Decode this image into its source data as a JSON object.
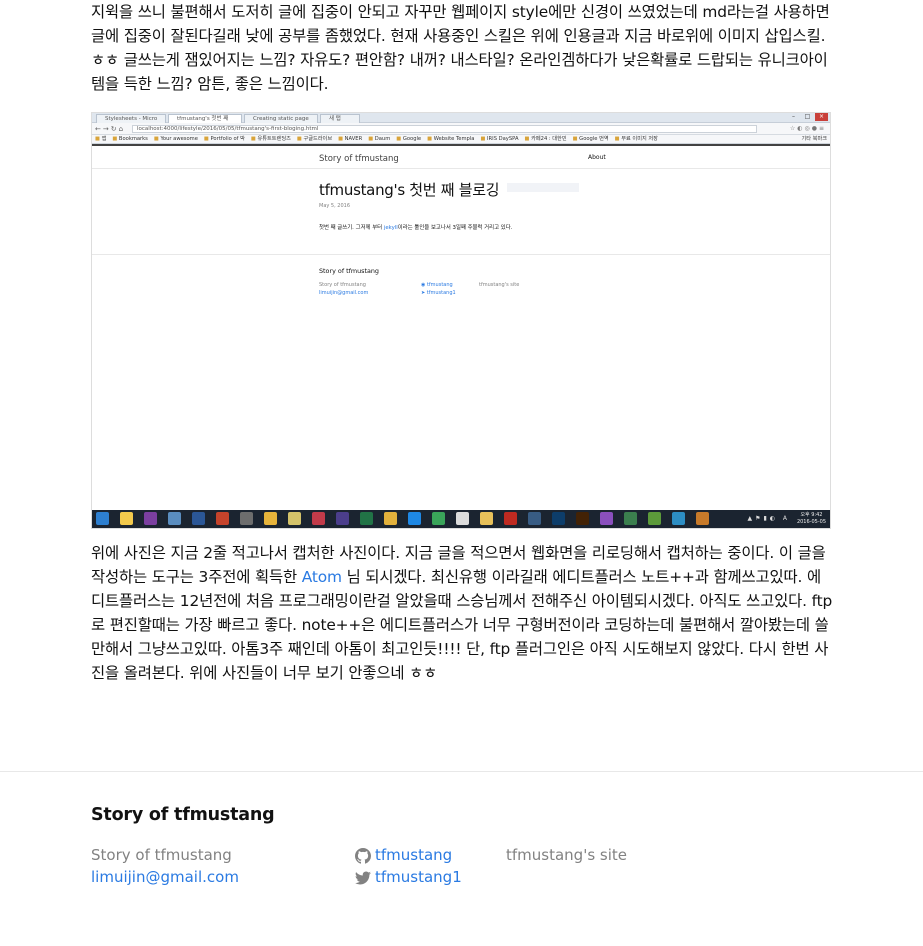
{
  "post": {
    "para1": "지윅을 쓰니 불편해서 도저히 글에 집중이 안되고 자꾸만 웹페이지 style에만 신경이 쓰였었는데 md라는걸 사용하면 글에 집중이 잘된다길래 낮에 공부를 좀했었다. 현재 사용중인 스킬은 위에 인용글과 지금 바로위에 이미지 삽입스킬. ㅎㅎ 글쓰는게 잼있어지는 느낌? 자유도? 편안함? 내꺼? 내스타일? 온라인겜하다가 낮은확률로 드랍되는 유니크아이템을 득한 느낌? 암튼, 좋은 느낌이다.",
    "para2_a": "위에 사진은 지금 2줄 적고나서 캡처한 사진이다. 지금 글을 적으면서 웹화면을 리로딩해서 캡처하는 중이다. 이 글을 작성하는 도구는 3주전에 획득한 ",
    "para2_link": "Atom",
    "para2_b": " 님 되시겠다. 최신유행 이라길래 에디트플러스 노트++과 함께쓰고있따. 에디트플러스는 12년전에 처음 프로그래밍이란걸 알았을때 스승님께서 전해주신 아이템되시겠다. 아직도 쓰고있다. ftp로 편진할때는 가장 빠르고 좋다. note++은 에디트플러스가 너무 구형버전이라 코딩하는데 불편해서 깔아봤는데 쓸만해서 그냥쓰고있따. 아톰3주 째인데 아톰이 최고인듯!!!! 단, ftp 플러그인은 아직 시도해보지 않았다. 다시 한번 사진을 올려본다. 위에 사진들이 너무 보기 안좋으네 ㅎㅎ"
  },
  "screenshot": {
    "tabs": [
      "Stylesheets - Micro",
      "tfmustang's 첫번 째",
      "Creating static page",
      "새 탭"
    ],
    "url": "localhost:4000/lifestyle/2016/05/05/tfmustang's-first-bloging.html",
    "bookmarks": [
      "앱",
      "Bookmarks",
      "Your awesome",
      "Portfolio of 박",
      "유튜트트렌딩즈",
      "구글드라이브",
      "NAVER",
      "Daum",
      "Google",
      "Website Templa",
      "IRIS DaySPA",
      "카페24 : 대한민",
      "Google 번역",
      "무료 이미지 저장"
    ],
    "bookmarks_other": "기타 북마크",
    "site_title": "Story of tfmustang",
    "nav_about": "About",
    "post_title": "tfmustang's 첫번 째 블로깅",
    "post_date": "May 5, 2016",
    "body_before": "첫번 째 글쓰기. 그저께 부터 ",
    "body_link": "jekyll",
    "body_after": "이라는 툴인을 보고나서 3일째 주물럭 거리고 있다.",
    "footer_heading": "Story of tfmustang",
    "footer_name": "Story of tfmustang",
    "footer_email": "limuijin@gmail.com",
    "footer_github": "tfmustang",
    "footer_twitter": "tfmustang1",
    "footer_desc": "tfmustang's site",
    "clock_time": "오후 9:42",
    "clock_date": "2016-05-05",
    "tray_lang": "A"
  },
  "footer": {
    "heading": "Story of tfmustang",
    "name": "Story of tfmustang",
    "email": "limuijin@gmail.com",
    "github": "tfmustang",
    "twitter": "tfmustang1",
    "description": "tfmustang's site"
  },
  "colors": {
    "link": "#2a7ae2",
    "muted": "#828282",
    "text": "#111111",
    "taskbar": "#1b2430"
  },
  "icons": {
    "github": "github-icon",
    "twitter": "twitter-icon"
  }
}
